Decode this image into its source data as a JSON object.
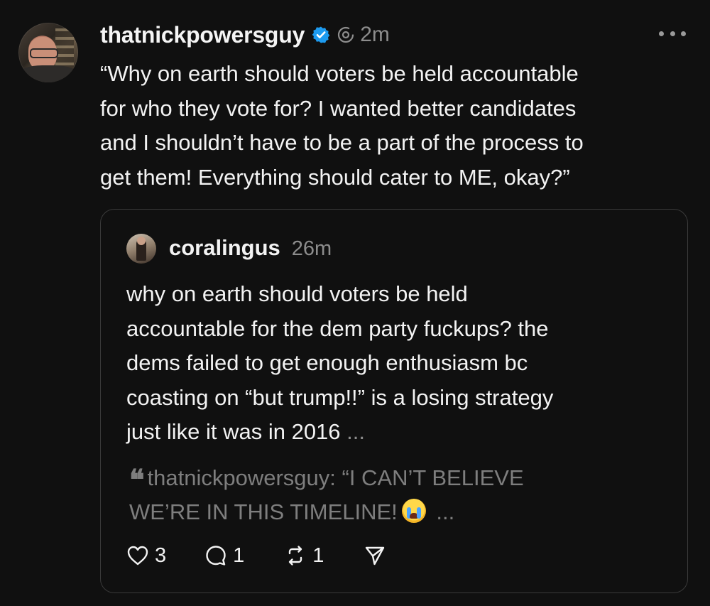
{
  "post": {
    "username": "thatnickpowersguy",
    "time": "2m",
    "text": "“Why on earth should voters be held accountable\nfor who they vote for? I wanted better candidates\nand I shouldn’t have to be a part of the process to\nget them! Everything should cater to ME, okay?”",
    "icons": [
      "verified-badge-icon",
      "threads-icon",
      "more-options-icon"
    ]
  },
  "quoted": {
    "username": "coralingus",
    "time": "26m",
    "text": "why on earth should voters be held\naccountable for the dem party fuckups? the\ndems failed to get enough enthusiasm bc\ncoasting on “but trump!!” is a losing strategy\njust like it was in 2016 ",
    "text_ellipsis": "...",
    "nested_quote": {
      "mark": "❝",
      "text_before_emoji": "thatnickpowersguy: “I CAN’T BELIEVE\nWE’RE IN THIS TIMELINE!",
      "emoji": "loudly-crying-face",
      "text_after_emoji": " ..."
    },
    "actions": {
      "likes": "3",
      "replies": "1",
      "reposts": "1"
    }
  },
  "colors": {
    "background": "#101010",
    "text": "#f3f3f3",
    "muted": "#8d8d8d",
    "border": "#3a3a3a",
    "verified": "#1d9bf0"
  }
}
